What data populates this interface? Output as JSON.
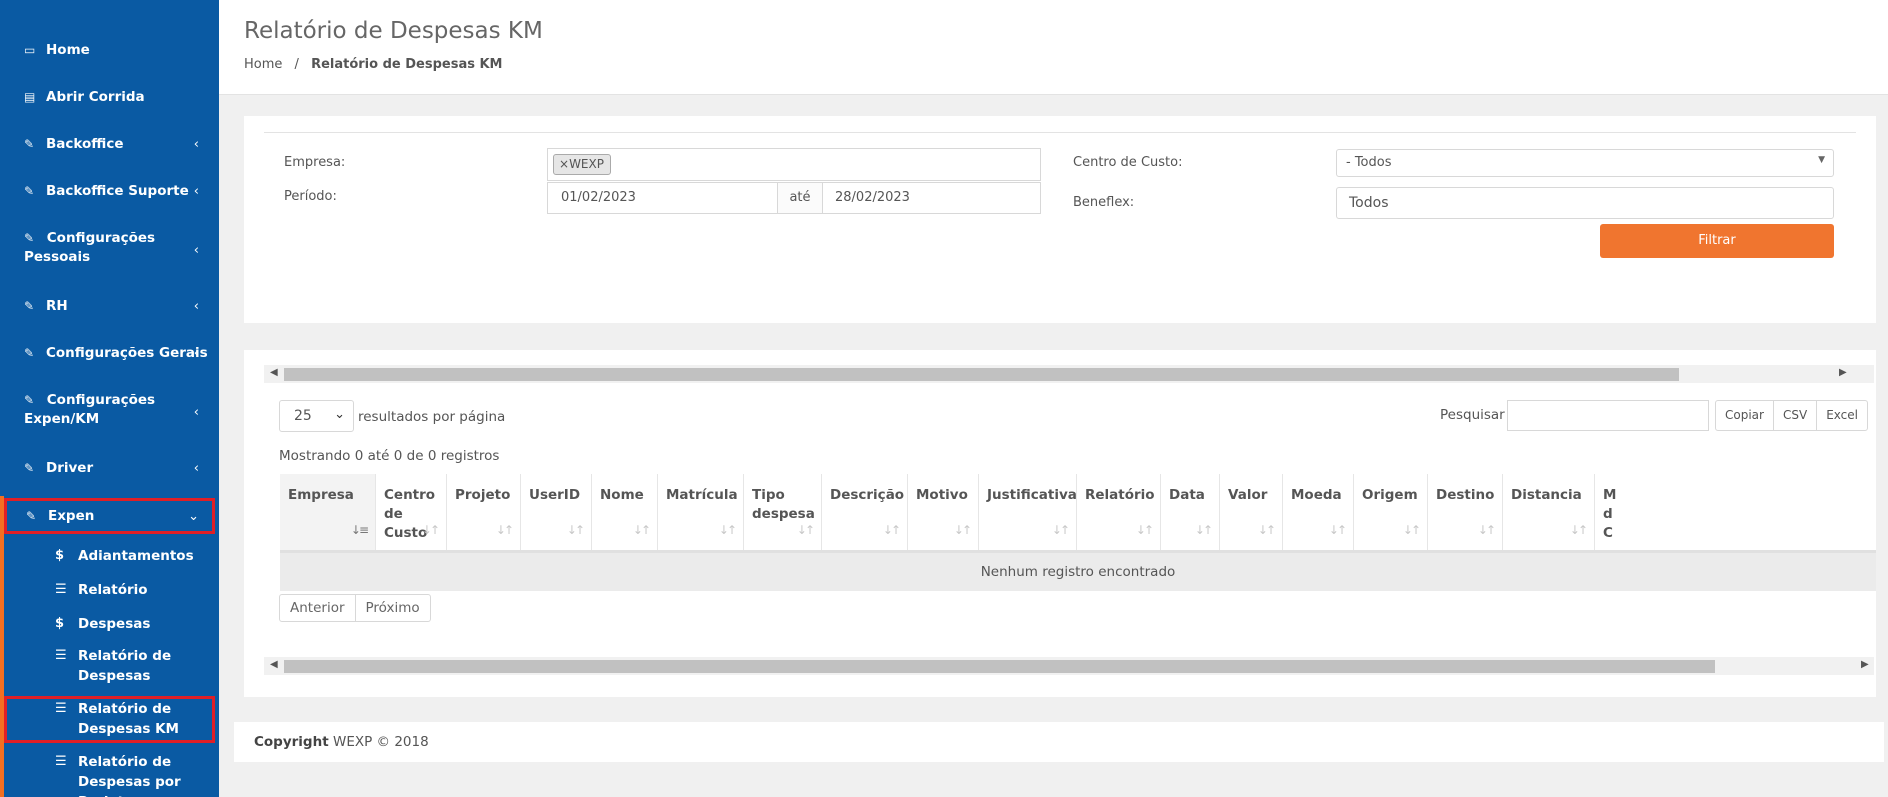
{
  "sidebar": {
    "items": [
      {
        "label": "Home",
        "icon": "laptop-icon"
      },
      {
        "label": "Abrir Corrida",
        "icon": "calendar-icon"
      },
      {
        "label": "Backoffice",
        "icon": "edit-icon"
      },
      {
        "label": "Backoffice Suporte",
        "icon": "edit-icon"
      },
      {
        "label": "Configurações",
        "label2": "Pessoais",
        "icon": "edit-icon"
      },
      {
        "label": "RH",
        "icon": "edit-icon"
      },
      {
        "label": "Configurações Gerais",
        "icon": "edit-icon"
      },
      {
        "label": "Configurações",
        "label2": "Expen/KM",
        "icon": "edit-icon"
      },
      {
        "label": "Driver",
        "icon": "edit-icon"
      },
      {
        "label": "Expen",
        "icon": "edit-icon"
      }
    ],
    "subitems": [
      {
        "label": "Adiantamentos",
        "icon": "dollar-icon"
      },
      {
        "label": "Relatório",
        "icon": "list-icon"
      },
      {
        "label": "Despesas",
        "icon": "dollar-icon"
      },
      {
        "label": "Relatório de",
        "label2": "Despesas",
        "icon": "list-icon"
      },
      {
        "label": "Relatório de",
        "label2": "Despesas KM",
        "icon": "list-icon"
      },
      {
        "label": "Relatório de",
        "label2": "Despesas por Projeto",
        "icon": "list-icon"
      }
    ]
  },
  "header": {
    "title": "Relatório de Despesas KM",
    "breadcrumb_home": "Home",
    "breadcrumb_sep": "/",
    "breadcrumb_current": "Relatório de Despesas KM"
  },
  "filters": {
    "empresa_label": "Empresa:",
    "empresa_tag": "WEXP",
    "empresa_tag_remove": "×",
    "periodo_label": "Período:",
    "periodo_start": "01/02/2023",
    "periodo_ate": "até",
    "periodo_end": "28/02/2023",
    "centro_label": "Centro de Custo:",
    "centro_value": "- Todos",
    "beneflex_label": "Beneflex:",
    "beneflex_value": "Todos",
    "filter_button": "Filtrar"
  },
  "table": {
    "page_size": "25",
    "page_size_suffix": "resultados por página",
    "search_label": "Pesquisar",
    "buttons": [
      "Copiar",
      "CSV",
      "Excel"
    ],
    "info": "Mostrando 0 até 0 de 0 registros",
    "columns": [
      {
        "l1": "Empresa"
      },
      {
        "l1": "Centro",
        "l2": "de",
        "l3": "Custo"
      },
      {
        "l1": "Projeto"
      },
      {
        "l1": "UserID"
      },
      {
        "l1": "Nome"
      },
      {
        "l1": "Matrícula"
      },
      {
        "l1": "Tipo",
        "l2": "despesa"
      },
      {
        "l1": "Descrição"
      },
      {
        "l1": "Motivo"
      },
      {
        "l1": "Justificativa"
      },
      {
        "l1": "Relatório"
      },
      {
        "l1": "Data"
      },
      {
        "l1": "Valor"
      },
      {
        "l1": "Moeda"
      },
      {
        "l1": "Origem"
      },
      {
        "l1": "Destino"
      },
      {
        "l1": "Distancia"
      },
      {
        "l1": "M",
        "l2": "d",
        "l3": "C"
      }
    ],
    "empty_message": "Nenhum registro encontrado",
    "prev": "Anterior",
    "next": "Próximo"
  },
  "footer": {
    "copyright_label": "Copyright",
    "copyright_text": "WEXP © 2018"
  },
  "colors": {
    "sidebar_bg": "#0a5aa3",
    "accent_orange": "#f0752f",
    "highlight_red": "#e01f26"
  }
}
